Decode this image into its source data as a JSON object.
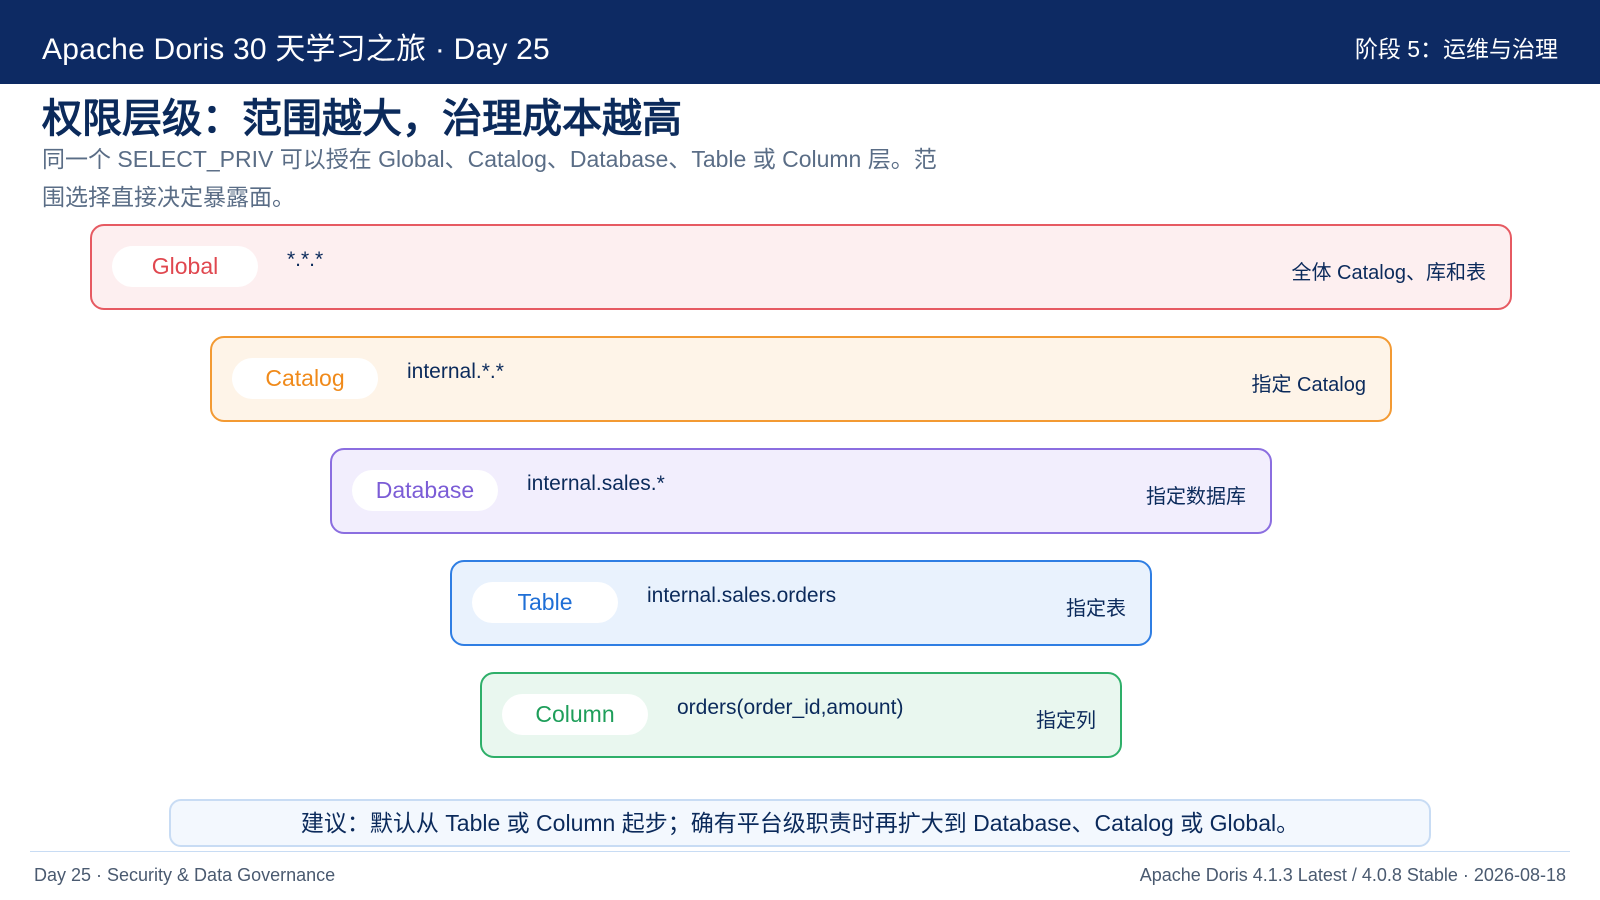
{
  "header": {
    "title": "Apache Doris 30 天学习之旅 · Day 25",
    "stage": "阶段 5：运维与治理"
  },
  "slide": {
    "heading": "权限层级：范围越大，治理成本越高",
    "subtitle": "同一个 SELECT_PRIV 可以授在 Global、Catalog、Database、Table 或 Column 层。范围选择直接决定暴露面。"
  },
  "levels": [
    {
      "name": "Global",
      "scope": "*.*.*",
      "desc": "全体 Catalog、库和表",
      "color": "#e0474f",
      "bg": "#fdeff0",
      "border": "#e65a62"
    },
    {
      "name": "Catalog",
      "scope": "internal.*.*",
      "desc": "指定 Catalog",
      "color": "#f08a1a",
      "bg": "#fef4e8",
      "border": "#f39a33"
    },
    {
      "name": "Database",
      "scope": "internal.sales.*",
      "desc": "指定数据库",
      "color": "#7b5cd6",
      "bg": "#f2eefd",
      "border": "#8b6ee0"
    },
    {
      "name": "Table",
      "scope": "internal.sales.orders",
      "desc": "指定表",
      "color": "#1f6fd6",
      "bg": "#e9f2fd",
      "border": "#2f7ee3"
    },
    {
      "name": "Column",
      "scope": "orders(order_id,amount)",
      "desc": "指定列",
      "color": "#1e9e5a",
      "bg": "#e9f7ef",
      "border": "#2eaf69"
    }
  ],
  "tip": "建议：默认从 Table 或 Column 起步；确有平台级职责时再扩大到 Database、Catalog 或 Global。",
  "footer": {
    "left": "Day 25 · Security & Data Governance",
    "right": "Apache Doris 4.1.3 Latest / 4.0.8 Stable · 2026-08-18"
  }
}
